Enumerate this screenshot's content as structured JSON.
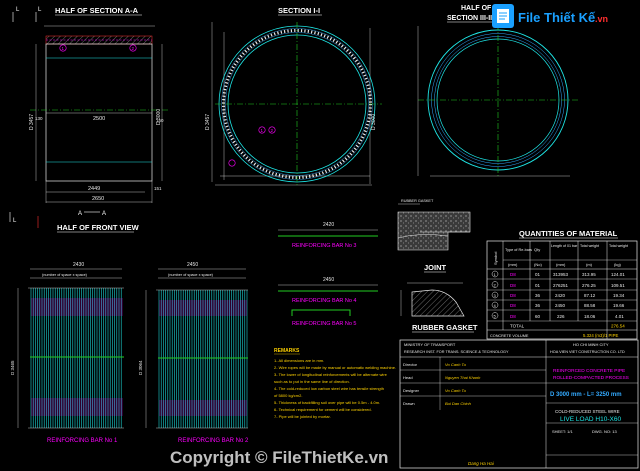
{
  "colors": {
    "background": "#000000",
    "title": "#ffffff",
    "dim": "#e8e8e8",
    "concrete": "#1ee6e6",
    "steel_rings": "#33aaff",
    "rebar_green": "#22cc22",
    "highlight": "#ff00ff",
    "mark_red": "#ff3030",
    "table_cyan": "#00e5ff",
    "note_yellow": "#ffd200",
    "watermark_blue": "#1aa0ff",
    "watermark_red": "#ff2e2e"
  },
  "watermark": {
    "brand": "File Thiết Kế",
    "brand_suffix": ".vn",
    "copyright": "Copyright © FileThietKe.vn"
  },
  "titles": {
    "section_aa": "HALF OF SECTION A-A",
    "section_ii": "SECTION I-I",
    "section_iii_1": "HALF OF",
    "section_iii_2": "SECTION III-III",
    "front_view": "HALF OF FRONT VIEW",
    "joint": "JOINT",
    "rubber_gasket": "RUBBER GASKET",
    "rubber_label": "RUBBER GASKET"
  },
  "markers": {
    "section_l": "L",
    "section_aa_left": "A",
    "section_aa_right": "A",
    "front_view_l": "L"
  },
  "section_aa_dims": {
    "inner_width": "2500",
    "length_lower": "2449",
    "length_total": "2650",
    "height_left": "D 3457",
    "height_right": "D 3000",
    "end_1": "151",
    "end_2": "150",
    "callout_1": "1",
    "callout_2": "2",
    "side_1": "130",
    "side_2": "50"
  },
  "section_ii_dims": {
    "dia_left": "D 3457",
    "dia_right": "D 3000",
    "callout_1": "1",
    "callout_2": "2"
  },
  "rebar_bars": {
    "bar3": "REINFORCING BAR No 3",
    "bar4": "REINFORCING BAR No 4",
    "bar5": "REINFORCING BAR No 5",
    "len3": "2420",
    "len4": "2450"
  },
  "cages": {
    "cage1_label": "REINFORCING BAR No 1",
    "cage2_label": "REINFORCING BAR No 2",
    "cage1_top": "2430",
    "cage1_space": "(number of space x space)",
    "cage2_top": "2450",
    "cage2_space": "(number of space x space)",
    "cage1_side": "D 3465",
    "cage2_side": "D 3064"
  },
  "material_table": {
    "title": "QUANTITIES OF MATERIAL",
    "headers": [
      "Symbol",
      "Type of Re-bars",
      "Qty",
      "Length of 01 bar",
      "Total weight",
      "Total weight"
    ],
    "units": [
      "",
      "(mm)",
      "(No)",
      "(mm)",
      "(m)",
      "(kg)"
    ],
    "rows": [
      {
        "no": "1",
        "type": "D8",
        "qty": "01",
        "length": "313953",
        "weight": "313.95",
        "total": "124.01"
      },
      {
        "no": "2",
        "type": "D8",
        "qty": "01",
        "length": "276251",
        "weight": "276.25",
        "total": "109.51"
      },
      {
        "no": "3",
        "type": "D8",
        "qty": "36",
        "length": "2420",
        "weight": "87.12",
        "total": "19.34"
      },
      {
        "no": "4",
        "type": "D8",
        "qty": "36",
        "length": "2450",
        "weight": "88.58",
        "total": "19.66"
      },
      {
        "no": "5",
        "type": "D8",
        "qty": "60",
        "length": "226",
        "weight": "18.06",
        "total": "4.01"
      }
    ],
    "total_label": "TOTAL",
    "total_value": "276.54",
    "concrete_label": "CONCRETE VOLUME",
    "concrete_value": "5.324 (m3)/1 PIPE"
  },
  "notes": {
    "title": "REMARKS",
    "lines": [
      "1- All dimensions are in mm.",
      "2- Wire ropes will be made by manual or automatic welding machine.",
      "3- The lower of longitudinal reinforcements will be alternate wire",
      "   such as to put in the same line of direction.",
      "4- The cold-reduced low carbon steel wire has tensile strength",
      "   of 5800 kg/cm2.",
      "5- Thickness of backfilling soil over pipe will be 0.5m - 4.0m.",
      "6- Technical requirement for cement will be considered.",
      "7- Pipe will be jointed by mortar."
    ]
  },
  "title_block": {
    "ministry": "MINISTRY OF TRANSPORT",
    "institute": "RESEARCH INST. FOR TRANS. SCIENCE & TECHNOLOGY",
    "city": "HO CHI MINH CITY",
    "company": "HOA VIEN VIET CONSTRUCTION CO. LTD",
    "role1": "Director",
    "name1": "Vo Canh Tu",
    "role2": "Head",
    "name2": "Nguyen Thai Khanh",
    "role3": "Designer",
    "name3": "Vo Canh Tu",
    "role4": "Drawn",
    "name4": "Bui Dan Chinh",
    "project1": "REINFORCED CONCRETE PIPE",
    "project2": "ROLLED-COMPACTED PROCESS",
    "size": "D 3000 mm - L= 3250 mm",
    "drawing1": "COLD-REDUCED STEEL WIRE",
    "drawing2": "LIVE LOAD H10-X60",
    "sheet": "SHEET: 1/1",
    "scale": "DWG. NO: 13",
    "signature": "Dang Ha Hai"
  }
}
